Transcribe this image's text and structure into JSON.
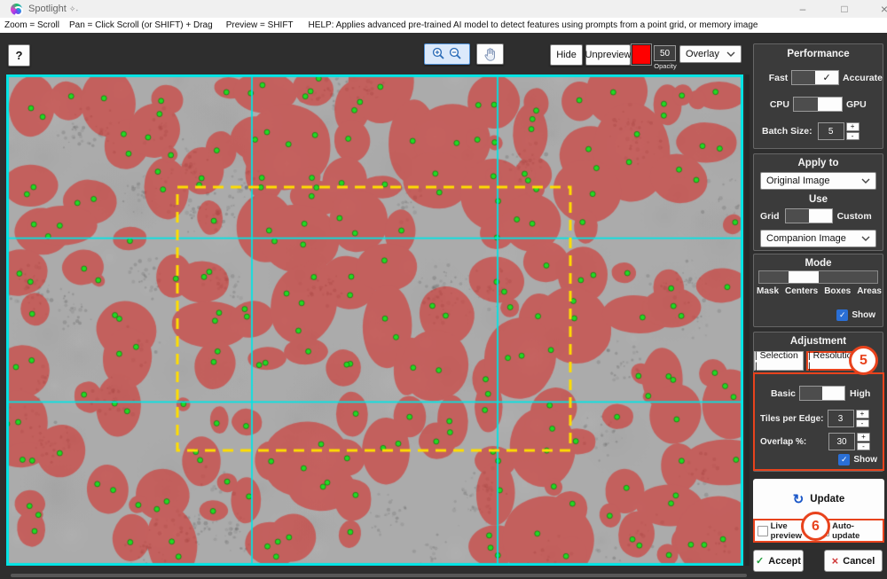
{
  "titlebar": {
    "app_title": "Spotlight",
    "sparkle": "✧˖",
    "minimize": "–",
    "maximize": "□",
    "close": "×"
  },
  "menubar": {
    "hint_zoom": "Zoom = Scroll",
    "hint_pan": "Pan = Click Scroll (or SHIFT) + Drag",
    "hint_preview": "Preview = SHIFT",
    "help": "HELP:  Applies advanced pre-trained AI model to detect features using prompts from a point grid, or memory image"
  },
  "toolbar": {
    "help_button": "?",
    "hide": "Hide",
    "unpreview": "Unpreview",
    "swatch_color": "#ff0000",
    "opacity_value": "50",
    "opacity_label": "Opacity",
    "overlay": "Overlay"
  },
  "viewer": {
    "tiles_per_edge": 3,
    "grid_color": "#00e5e6",
    "selection_color": "#ffdd00",
    "selection_rect": [
      193,
      127,
      443,
      297
    ],
    "bg_color": "#ababab",
    "blob_color": "#d52b26",
    "blob_opacity": 0.58,
    "dot_color": "#24d824",
    "seed": 11
  },
  "sidebar": {
    "performance": {
      "title": "Performance",
      "fast": "Fast",
      "accurate": "Accurate",
      "check": "✓",
      "cpu": "CPU",
      "gpu": "GPU",
      "batch_label": "Batch Size:",
      "batch_value": "5"
    },
    "apply_to": {
      "title": "Apply to",
      "target": "Original Image",
      "use_label": "Use",
      "grid": "Grid",
      "custom": "Custom",
      "companion": "Companion Image"
    },
    "mode": {
      "title": "Mode",
      "options": [
        "Mask",
        "Centers",
        "Boxes",
        "Areas"
      ],
      "selected": "Centers",
      "show_label": "Show",
      "check": "✓"
    },
    "adjustment": {
      "title": "Adjustment",
      "tab_selection": "| Selection |",
      "tab_resolution": "| Resolution |",
      "badge": "5",
      "basic": "Basic",
      "high": "High",
      "tiles_label": "Tiles per Edge:",
      "tiles_value": "3",
      "overlap_label": "Overlap %:",
      "overlap_value": "30",
      "show_label": "Show",
      "check": "✓"
    },
    "update": {
      "icon": "↻",
      "label": "Update",
      "live_preview": "Live preview",
      "auto_update": "Auto-update",
      "badge": "6"
    },
    "footer": {
      "accept_icon": "✓",
      "accept": "Accept",
      "cancel_icon": "×",
      "cancel": "Cancel"
    }
  },
  "spinner": {
    "plus": "+",
    "minus": "-"
  }
}
